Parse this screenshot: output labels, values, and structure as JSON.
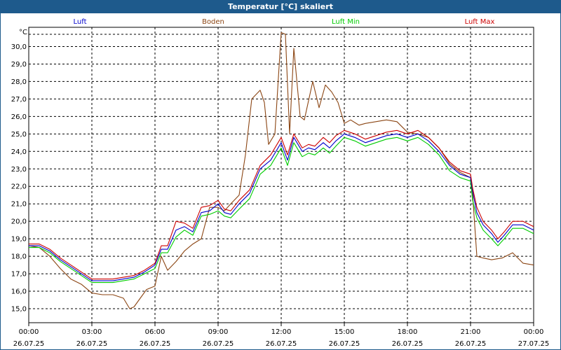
{
  "window": {
    "title": "Temperatur [°C] skaliert"
  },
  "chart_data": {
    "type": "line",
    "title": "Temperatur [°C] skaliert",
    "unit_label": "°C",
    "ylim": [
      14.2,
      31.1
    ],
    "y_ticks": [
      15.0,
      16.0,
      17.0,
      18.0,
      19.0,
      20.0,
      21.0,
      22.0,
      23.0,
      24.0,
      25.0,
      26.0,
      27.0,
      28.0,
      29.0,
      30.0
    ],
    "y_tick_labels": [
      "15,0",
      "16,0",
      "17,0",
      "18,0",
      "19,0",
      "20,0",
      "21,0",
      "22,0",
      "23,0",
      "24,0",
      "25,0",
      "26,0",
      "27,0",
      "28,0",
      "29,0",
      "30,0"
    ],
    "xlim": [
      0,
      24
    ],
    "x_ticks": [
      0,
      3,
      6,
      9,
      12,
      15,
      18,
      21,
      24
    ],
    "x_tick_times": [
      "00:00",
      "03:00",
      "06:00",
      "09:00",
      "12:00",
      "15:00",
      "18:00",
      "21:00",
      "00:00"
    ],
    "x_tick_dates": [
      "26.07.25",
      "26.07.25",
      "26.07.25",
      "26.07.25",
      "26.07.25",
      "26.07.25",
      "26.07.25",
      "26.07.25",
      "27.07.25"
    ],
    "grid": true,
    "legend_position": "top",
    "series": [
      {
        "name": "Luft",
        "color": "#0000cc",
        "x": [
          0,
          0.5,
          1,
          1.5,
          2,
          2.5,
          3,
          3.5,
          4,
          4.5,
          5,
          5.5,
          6,
          6.3,
          6.6,
          7,
          7.4,
          7.8,
          8.2,
          8.6,
          9,
          9.3,
          9.6,
          10,
          10.5,
          11,
          11.5,
          12,
          12.3,
          12.6,
          13,
          13.3,
          13.6,
          14,
          14.3,
          14.6,
          15,
          15.5,
          16,
          16.5,
          17,
          17.5,
          18,
          18.5,
          19,
          19.5,
          20,
          20.5,
          21,
          21.1,
          21.3,
          21.6,
          22,
          22.3,
          22.6,
          23,
          23.5,
          24
        ],
        "values": [
          18.6,
          18.6,
          18.3,
          17.8,
          17.4,
          17.0,
          16.6,
          16.6,
          16.6,
          16.7,
          16.8,
          17.1,
          17.5,
          18.4,
          18.4,
          19.5,
          19.7,
          19.4,
          20.5,
          20.6,
          21.0,
          20.5,
          20.4,
          21.0,
          21.6,
          23.0,
          23.5,
          24.5,
          23.5,
          24.8,
          24.0,
          24.2,
          24.1,
          24.5,
          24.2,
          24.6,
          25.0,
          24.8,
          24.5,
          24.7,
          24.9,
          25.0,
          24.8,
          25.0,
          24.6,
          24.0,
          23.2,
          22.7,
          22.5,
          21.7,
          20.5,
          19.8,
          19.3,
          18.8,
          19.2,
          19.8,
          19.8,
          19.5
        ]
      },
      {
        "name": "Boden",
        "color": "#8b4513",
        "x": [
          0,
          0.5,
          1,
          1.5,
          2,
          2.5,
          3,
          3.5,
          4,
          4.5,
          4.8,
          5,
          5.3,
          5.6,
          6,
          6.3,
          6.6,
          7,
          7.4,
          7.8,
          8.2,
          8.6,
          9,
          9.3,
          9.6,
          10,
          10.3,
          10.6,
          11,
          11.2,
          11.4,
          11.7,
          12,
          12.2,
          12.4,
          12.6,
          12.9,
          13.1,
          13.5,
          13.8,
          14.1,
          14.4,
          14.7,
          15,
          15.3,
          15.7,
          16,
          16.5,
          17,
          17.5,
          18,
          18.5,
          19,
          19.5,
          20,
          20.5,
          21,
          21.1,
          21.3,
          21.6,
          22,
          22.5,
          23,
          23.5,
          24
        ],
        "values": [
          18.6,
          18.5,
          18.0,
          17.3,
          16.7,
          16.4,
          15.9,
          15.8,
          15.8,
          15.6,
          15.0,
          15.1,
          15.6,
          16.1,
          16.3,
          18.0,
          17.2,
          17.7,
          18.3,
          18.7,
          19.0,
          20.8,
          20.8,
          20.6,
          21.0,
          21.5,
          23.8,
          27.0,
          27.5,
          26.8,
          24.4,
          25.0,
          30.8,
          30.7,
          25.0,
          29.9,
          26.0,
          25.8,
          28.0,
          26.5,
          27.8,
          27.4,
          26.8,
          25.6,
          25.8,
          25.5,
          25.6,
          25.7,
          25.8,
          25.7,
          25.1,
          25.0,
          24.8,
          24.2,
          23.3,
          22.8,
          22.5,
          21.5,
          18.0,
          17.9,
          17.8,
          17.9,
          18.2,
          17.6,
          17.5
        ]
      },
      {
        "name": "Luft Min",
        "color": "#00cc00",
        "x": [
          0,
          0.5,
          1,
          1.5,
          2,
          2.5,
          3,
          3.5,
          4,
          4.5,
          5,
          5.5,
          6,
          6.3,
          6.6,
          7,
          7.4,
          7.8,
          8.2,
          8.6,
          9,
          9.3,
          9.6,
          10,
          10.5,
          11,
          11.5,
          12,
          12.3,
          12.6,
          13,
          13.3,
          13.6,
          14,
          14.3,
          14.6,
          15,
          15.5,
          16,
          16.5,
          17,
          17.5,
          18,
          18.5,
          19,
          19.5,
          20,
          20.5,
          21,
          21.1,
          21.3,
          21.6,
          22,
          22.3,
          22.6,
          23,
          23.5,
          24
        ],
        "values": [
          18.5,
          18.5,
          18.2,
          17.7,
          17.3,
          16.9,
          16.5,
          16.5,
          16.5,
          16.6,
          16.7,
          17.0,
          17.3,
          18.2,
          18.2,
          19.1,
          19.5,
          19.2,
          20.3,
          20.4,
          20.6,
          20.3,
          20.2,
          20.7,
          21.3,
          22.7,
          23.2,
          24.2,
          23.2,
          24.5,
          23.7,
          23.9,
          23.8,
          24.2,
          23.9,
          24.3,
          24.8,
          24.6,
          24.3,
          24.5,
          24.7,
          24.8,
          24.6,
          24.8,
          24.4,
          23.8,
          22.9,
          22.5,
          22.3,
          21.2,
          20.2,
          19.5,
          19.0,
          18.6,
          19.0,
          19.6,
          19.6,
          19.3
        ]
      },
      {
        "name": "Luft Max",
        "color": "#cc0000",
        "x": [
          0,
          0.5,
          1,
          1.5,
          2,
          2.5,
          3,
          3.5,
          4,
          4.5,
          5,
          5.5,
          6,
          6.3,
          6.6,
          7,
          7.4,
          7.8,
          8.2,
          8.6,
          9,
          9.3,
          9.6,
          10,
          10.5,
          11,
          11.5,
          12,
          12.3,
          12.6,
          13,
          13.3,
          13.6,
          14,
          14.3,
          14.6,
          15,
          15.5,
          16,
          16.5,
          17,
          17.5,
          18,
          18.5,
          19,
          19.5,
          20,
          20.5,
          21,
          21.1,
          21.3,
          21.6,
          22,
          22.3,
          22.6,
          23,
          23.5,
          24
        ],
        "values": [
          18.7,
          18.7,
          18.4,
          17.9,
          17.5,
          17.1,
          16.7,
          16.7,
          16.7,
          16.8,
          16.9,
          17.2,
          17.6,
          18.6,
          18.6,
          20.0,
          19.9,
          19.6,
          20.8,
          20.9,
          21.2,
          20.7,
          20.6,
          21.2,
          21.8,
          23.2,
          23.8,
          24.8,
          23.8,
          25.0,
          24.2,
          24.4,
          24.3,
          24.8,
          24.5,
          24.9,
          25.2,
          25.0,
          24.7,
          24.9,
          25.1,
          25.2,
          25.0,
          25.2,
          24.8,
          24.2,
          23.4,
          22.9,
          22.7,
          21.9,
          20.8,
          20.0,
          19.5,
          19.0,
          19.4,
          20.0,
          20.0,
          19.7
        ]
      }
    ]
  }
}
